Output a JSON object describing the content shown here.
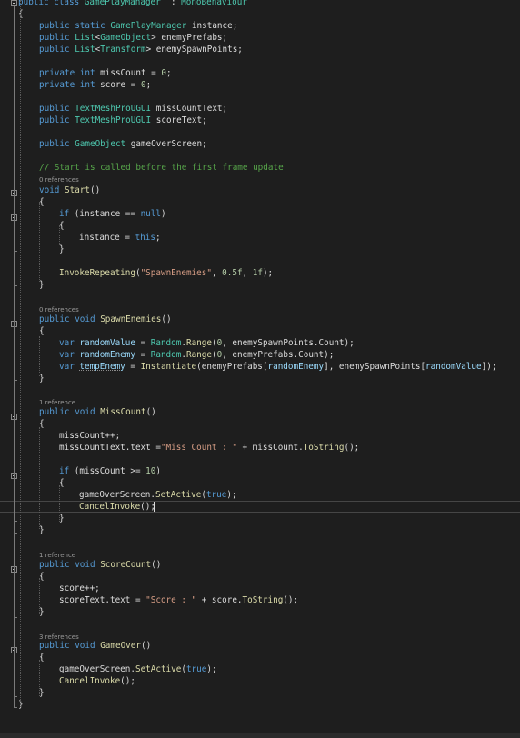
{
  "editor": {
    "file_class": "GamePlayManager",
    "codelens": {
      "zero": "0 references",
      "one": "1 reference",
      "three": "3 references"
    },
    "lines": [
      [
        [
          "kw",
          "public "
        ],
        [
          "kw",
          "class "
        ],
        [
          "ty",
          "GamePlayManager"
        ],
        [
          "",
          "  : "
        ],
        [
          "ty",
          "MonoBehaviour"
        ]
      ],
      [
        [
          "",
          "{"
        ]
      ],
      [
        [
          "kw",
          "public "
        ],
        [
          "kw",
          "static "
        ],
        [
          "ty",
          "GamePlayManager"
        ],
        [
          "",
          " instance;"
        ]
      ],
      [
        [
          "kw",
          "public "
        ],
        [
          "ty",
          "List"
        ],
        [
          "",
          "<"
        ],
        [
          "ty",
          "GameObject"
        ],
        [
          "",
          "> enemyPrefabs;"
        ]
      ],
      [
        [
          "kw",
          "public "
        ],
        [
          "ty",
          "List"
        ],
        [
          "",
          "<"
        ],
        [
          "ty",
          "Transform"
        ],
        [
          "",
          "> enemySpawnPoints;"
        ]
      ],
      [],
      [
        [
          "kw",
          "private "
        ],
        [
          "kw",
          "int "
        ],
        [
          "",
          "missCount = "
        ],
        [
          "nm",
          "0"
        ],
        [
          "",
          ";"
        ]
      ],
      [
        [
          "kw",
          "private "
        ],
        [
          "kw",
          "int "
        ],
        [
          "",
          "score = "
        ],
        [
          "nm",
          "0"
        ],
        [
          "",
          ";"
        ]
      ],
      [],
      [
        [
          "kw",
          "public "
        ],
        [
          "ty",
          "TextMeshProUGUI"
        ],
        [
          "",
          " missCountText;"
        ]
      ],
      [
        [
          "kw",
          "public "
        ],
        [
          "ty",
          "TextMeshProUGUI"
        ],
        [
          "",
          " scoreText;"
        ]
      ],
      [],
      [
        [
          "kw",
          "public "
        ],
        [
          "ty",
          "GameObject"
        ],
        [
          "",
          " gameOverScreen;"
        ]
      ],
      [],
      [
        [
          "cm",
          "// Start is called before the first frame update"
        ]
      ],
      [
        [
          "",
          "0 references"
        ]
      ],
      [
        [
          "kw",
          "void "
        ],
        [
          "mt",
          "Start"
        ],
        [
          "",
          "()"
        ]
      ],
      [
        [
          "",
          "{"
        ]
      ],
      [
        [
          "kw",
          "if "
        ],
        [
          "",
          "(instance == "
        ],
        [
          "kw",
          "null"
        ],
        [
          "",
          ")"
        ]
      ],
      [
        [
          "",
          "{"
        ]
      ],
      [
        [
          "",
          "instance = "
        ],
        [
          "kw",
          "this"
        ],
        [
          "",
          ";"
        ]
      ],
      [
        [
          "",
          "}"
        ]
      ],
      [],
      [
        [
          "mt",
          "InvokeRepeating"
        ],
        [
          "",
          "("
        ],
        [
          "st",
          "\"SpawnEnemies\""
        ],
        [
          "",
          ", "
        ],
        [
          "nm",
          "0.5f"
        ],
        [
          "",
          ", "
        ],
        [
          "nm",
          "1f"
        ],
        [
          "",
          ");"
        ]
      ],
      [
        [
          "",
          "}"
        ]
      ],
      [],
      [
        [
          "",
          "0 references"
        ]
      ],
      [
        [
          "kw",
          "public "
        ],
        [
          "kw",
          "void "
        ],
        [
          "mt",
          "SpawnEnemies"
        ],
        [
          "",
          "()"
        ]
      ],
      [
        [
          "",
          "{"
        ]
      ],
      [
        [
          "kw",
          "var "
        ],
        [
          "vr",
          "randomValue"
        ],
        [
          "",
          " = "
        ],
        [
          "ty",
          "Random"
        ],
        [
          "",
          "."
        ],
        [
          "mt",
          "Range"
        ],
        [
          "",
          "("
        ],
        [
          "nm",
          "0"
        ],
        [
          "",
          ", enemySpawnPoints.Count);"
        ]
      ],
      [
        [
          "kw",
          "var "
        ],
        [
          "vr",
          "randomEnemy"
        ],
        [
          "",
          " = "
        ],
        [
          "ty",
          "Random"
        ],
        [
          "",
          "."
        ],
        [
          "mt",
          "Range"
        ],
        [
          "",
          "("
        ],
        [
          "nm",
          "0"
        ],
        [
          "",
          ", enemyPrefabs.Count);"
        ]
      ],
      [
        [
          "kw",
          "var "
        ],
        [
          "vr",
          "tempEnemy"
        ],
        [
          "",
          " = "
        ],
        [
          "mt",
          "Instantiate"
        ],
        [
          "",
          "(enemyPrefabs["
        ],
        [
          "vr",
          "randomEnemy"
        ],
        [
          "",
          "], enemySpawnPoints["
        ],
        [
          "vr",
          "randomValue"
        ],
        [
          "",
          "]);"
        ]
      ],
      [
        [
          "",
          "}"
        ]
      ],
      [],
      [
        [
          "",
          "1 reference"
        ]
      ],
      [
        [
          "kw",
          "public "
        ],
        [
          "kw",
          "void "
        ],
        [
          "mt",
          "MissCount"
        ],
        [
          "",
          "()"
        ]
      ],
      [
        [
          "",
          "{"
        ]
      ],
      [
        [
          "",
          "missCount++;"
        ]
      ],
      [
        [
          "",
          "missCountText.text ="
        ],
        [
          "st",
          "\"Miss Count : \""
        ],
        [
          "",
          " + missCount."
        ],
        [
          "mt",
          "ToString"
        ],
        [
          "",
          "();"
        ]
      ],
      [],
      [
        [
          "kw",
          "if "
        ],
        [
          "",
          "(missCount >= "
        ],
        [
          "nm",
          "10"
        ],
        [
          "",
          ")"
        ]
      ],
      [
        [
          "",
          "{"
        ]
      ],
      [
        [
          "",
          "gameOverScreen."
        ],
        [
          "mt",
          "SetActive"
        ],
        [
          "",
          "("
        ],
        [
          "kw",
          "true"
        ],
        [
          "",
          ");"
        ]
      ],
      [
        [
          "mt",
          "CancelInvoke"
        ],
        [
          "",
          "();"
        ]
      ],
      [
        [
          "",
          "}"
        ]
      ],
      [
        [
          "",
          "}"
        ]
      ],
      [],
      [
        [
          "",
          "1 reference"
        ]
      ],
      [
        [
          "kw",
          "public "
        ],
        [
          "kw",
          "void "
        ],
        [
          "mt",
          "ScoreCount"
        ],
        [
          "",
          "()"
        ]
      ],
      [
        [
          "",
          "{"
        ]
      ],
      [
        [
          "",
          "score++;"
        ]
      ],
      [
        [
          "",
          "scoreText.text = "
        ],
        [
          "st",
          "\"Score : \""
        ],
        [
          "",
          " + score."
        ],
        [
          "mt",
          "ToString"
        ],
        [
          "",
          "();"
        ]
      ],
      [
        [
          "",
          "}"
        ]
      ],
      [],
      [
        [
          "",
          "3 references"
        ]
      ],
      [
        [
          "kw",
          "public "
        ],
        [
          "kw",
          "void "
        ],
        [
          "mt",
          "GameOver"
        ],
        [
          "",
          "()"
        ]
      ],
      [
        [
          "",
          "{"
        ]
      ],
      [
        [
          "",
          "gameOverScreen."
        ],
        [
          "mt",
          "SetActive"
        ],
        [
          "",
          "("
        ],
        [
          "kw",
          "true"
        ],
        [
          "",
          ");"
        ]
      ],
      [
        [
          "mt",
          "CancelInvoke"
        ],
        [
          "",
          "();"
        ]
      ],
      [
        [
          "",
          "}"
        ]
      ],
      [
        [
          "",
          "}"
        ]
      ]
    ]
  }
}
